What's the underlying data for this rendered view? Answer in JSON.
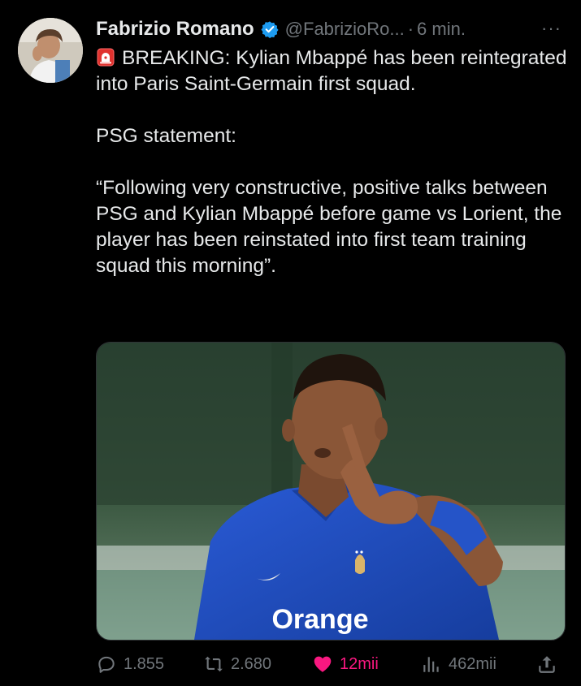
{
  "post": {
    "author_name": "Fabrizio Romano",
    "handle": "@FabrizioRo...",
    "separator": "·",
    "timestamp": "6 min.",
    "more": "···",
    "text": {
      "line1": "BREAKING: Kylian Mbappé has been reintegrated into Paris Saint-Germain first squad.",
      "line2": "PSG statement:",
      "line3": "“Following very constructive, positive talks between PSG and Kylian Mbappé before game vs Lorient, the player has been reinstated into first team training squad this morning”."
    },
    "media": {
      "shirt_sponsor": "Orange"
    },
    "actions": {
      "replies": "1.855",
      "reposts": "2.680",
      "likes": "12mii",
      "views": "462mii"
    }
  },
  "colors": {
    "background": "#000000",
    "text": "#e7e9ea",
    "secondary": "#71767b",
    "verified": "#1d9bf0",
    "like": "#f91880"
  },
  "icons": {
    "badge": "verified-icon",
    "emoji": "siren-icon",
    "reply": "reply-icon",
    "repost": "repost-icon",
    "like": "heart-icon",
    "views": "views-icon",
    "share": "share-icon"
  }
}
